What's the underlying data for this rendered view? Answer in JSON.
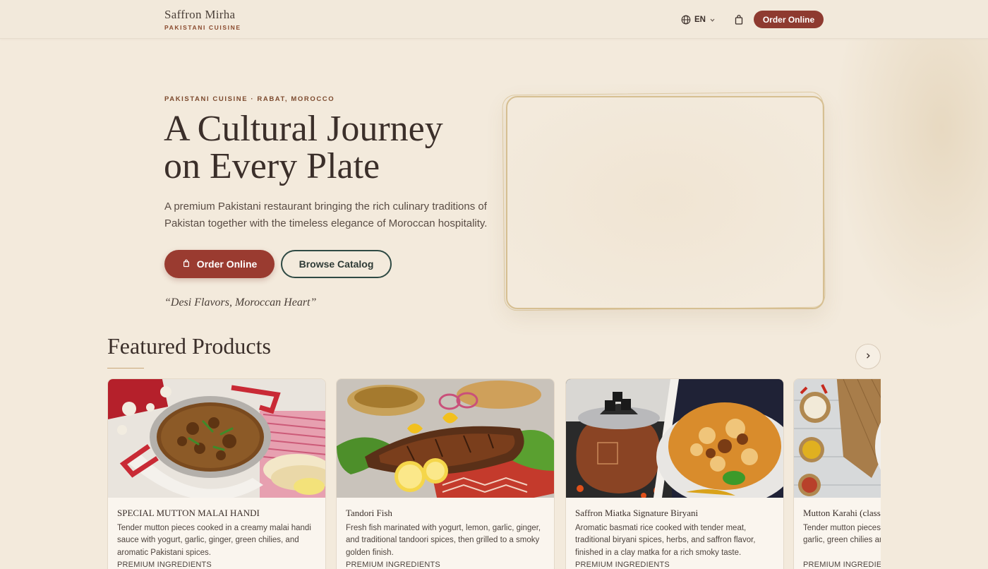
{
  "header": {
    "brand_name": "Saffron Mirha",
    "brand_sub": "PAKISTANI CUISINE",
    "language": "EN",
    "order_label": "Order Online"
  },
  "hero": {
    "eyebrow": "PAKISTANI CUISINE · RABAT, MOROCCO",
    "title_line1": "A Cultural Journey",
    "title_line2": "on Every Plate",
    "description": "A premium Pakistani restaurant bringing the rich culinary traditions of Pakistan together with the timeless elegance of Moroccan hospitality.",
    "order_label": "Order Online",
    "browse_label": "Browse Catalog",
    "tagline": "“Desi Flavors, Moroccan Heart”"
  },
  "featured": {
    "title": "Featured Products",
    "products": [
      {
        "name": "SPECIAL MUTTON MALAI HANDI",
        "description": "Tender mutton pieces cooked in a creamy malai handi sauce with yogurt, garlic, ginger, green chilies, and aromatic Pakistani spices.",
        "tag": "PREMIUM INGREDIENTS"
      },
      {
        "name": "Tandori Fish",
        "description": "Fresh fish marinated with yogurt, lemon, garlic, ginger, and traditional tandoori spices, then grilled to a smoky golden finish.",
        "tag": "PREMIUM INGREDIENTS"
      },
      {
        "name": "Saffron Miatka Signature Biryani",
        "description": "Aromatic basmati rice cooked with tender meat, traditional biryani spices, herbs, and saffron flavor, finished in a clay matka for a rich smoky taste.",
        "tag": "PREMIUM INGREDIENTS"
      },
      {
        "name": "Mutton Karahi (classic)",
        "description": "Tender mutton pieces cooked with tomatoes, ginger, garlic, green chilies and aromatic Pakistani spices.",
        "tag": "PREMIUM INGREDIENTS"
      }
    ]
  },
  "colors": {
    "background": "#f3eadc",
    "accent": "#9a3b30",
    "outline": "#2f4a44",
    "gold": "#d6bf92"
  }
}
